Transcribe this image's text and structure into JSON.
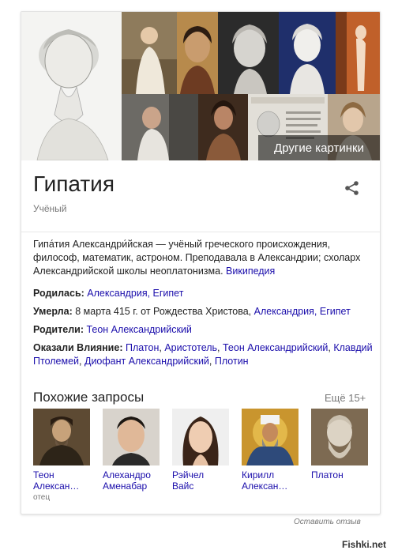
{
  "gallery": {
    "more_images_label": "Другие картинки"
  },
  "entity": {
    "title": "Гипатия",
    "subtitle": "Учёный"
  },
  "description": {
    "text": "Гипа́тия Александри́йская — учёный греческого происхождения, философ, математик, астроном. Преподавала в Александрии; схоларх Александрийской школы неоплатонизма.",
    "source_link": "Википедия"
  },
  "facts": {
    "born": {
      "label": "Родилась:",
      "value": "Александрия, Египет"
    },
    "died": {
      "label": "Умерла:",
      "date": "8 марта 415 г. от Рождества Христова,",
      "place": "Александрия, Египет"
    },
    "parents": {
      "label": "Родители:",
      "value": "Теон Александрийский"
    },
    "influenced": {
      "label": "Оказали Влияние:",
      "items": [
        "Платон",
        "Аристотель",
        "Теон Александрийский",
        "Клавдий Птолемей",
        "Диофант Александрийский",
        "Плотин"
      ]
    }
  },
  "related": {
    "title": "Похожие запросы",
    "more": "Ещё 15+",
    "items": [
      {
        "line1": "Теон",
        "line2": "Алексан…",
        "relation": "отец"
      },
      {
        "line1": "Алехандро",
        "line2": "Аменабар",
        "relation": ""
      },
      {
        "line1": "Рэйчел",
        "line2": "Вайс",
        "relation": ""
      },
      {
        "line1": "Кирилл",
        "line2": "Алексан…",
        "relation": ""
      },
      {
        "line1": "Платон",
        "line2": "",
        "relation": ""
      }
    ]
  },
  "feedback": "Оставить отзыв",
  "watermark": "Fishki.net",
  "icons": {
    "share": "share-icon"
  },
  "colors": {
    "link": "#1a0dab",
    "muted": "#777777"
  }
}
